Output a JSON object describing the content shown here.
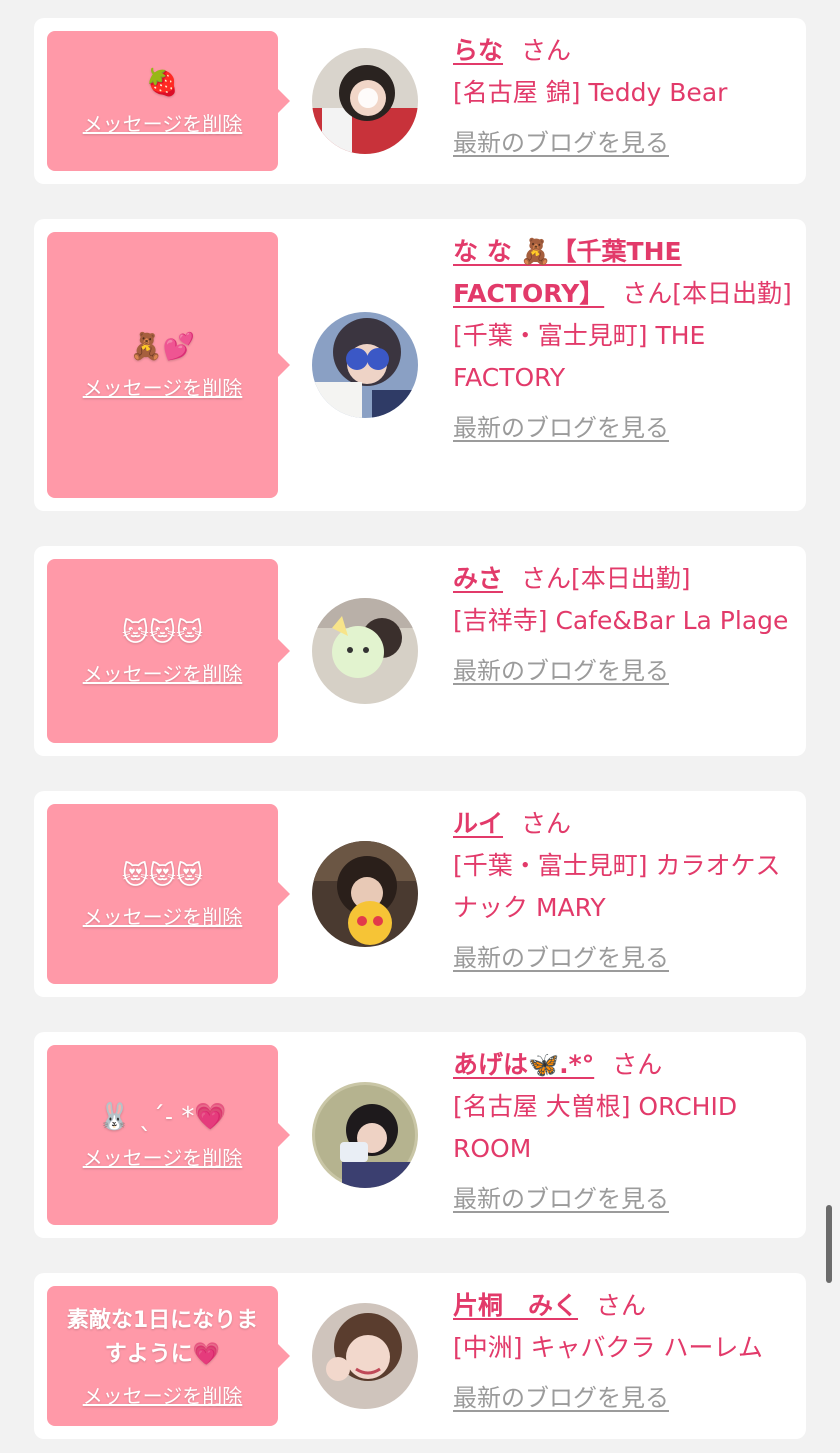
{
  "common": {
    "delete_label": "メッセージを削除",
    "blog_label": "最新のブログを見る",
    "san": "さん"
  },
  "entries": [
    {
      "message": "🍓",
      "name": "らな",
      "suffix": "",
      "shop": "[名古屋 錦] Teddy Bear"
    },
    {
      "message": "🧸💕",
      "name": "な な 🧸【千葉THE FACTORY】",
      "suffix": "[本日出勤]",
      "shop": "[千葉・富士見町] THE FACTORY"
    },
    {
      "message": "🐱🐱🐱",
      "name": "みさ",
      "suffix": "[本日出勤]",
      "shop": "[吉祥寺] Cafe&Bar La Plage"
    },
    {
      "message": "😻😻😻",
      "name": "ルイ",
      "suffix": "",
      "shop": "[千葉・富士見町] カラオケスナック MARY"
    },
    {
      "message": "🐰 ˎˊ˗ *💗",
      "name": "あげは🦋.*°",
      "suffix": "",
      "shop": "[名古屋 大曽根] ORCHID ROOM"
    },
    {
      "message": "素敵な1日になりますように💗",
      "name": "片桐　みく",
      "suffix": "",
      "shop": "[中洲] キャバクラ ハーレム"
    }
  ],
  "colors": {
    "bubble": "#ff99a8",
    "accent": "#e23a6a",
    "muted": "#9b9b9b",
    "background": "#f2f2f2"
  }
}
